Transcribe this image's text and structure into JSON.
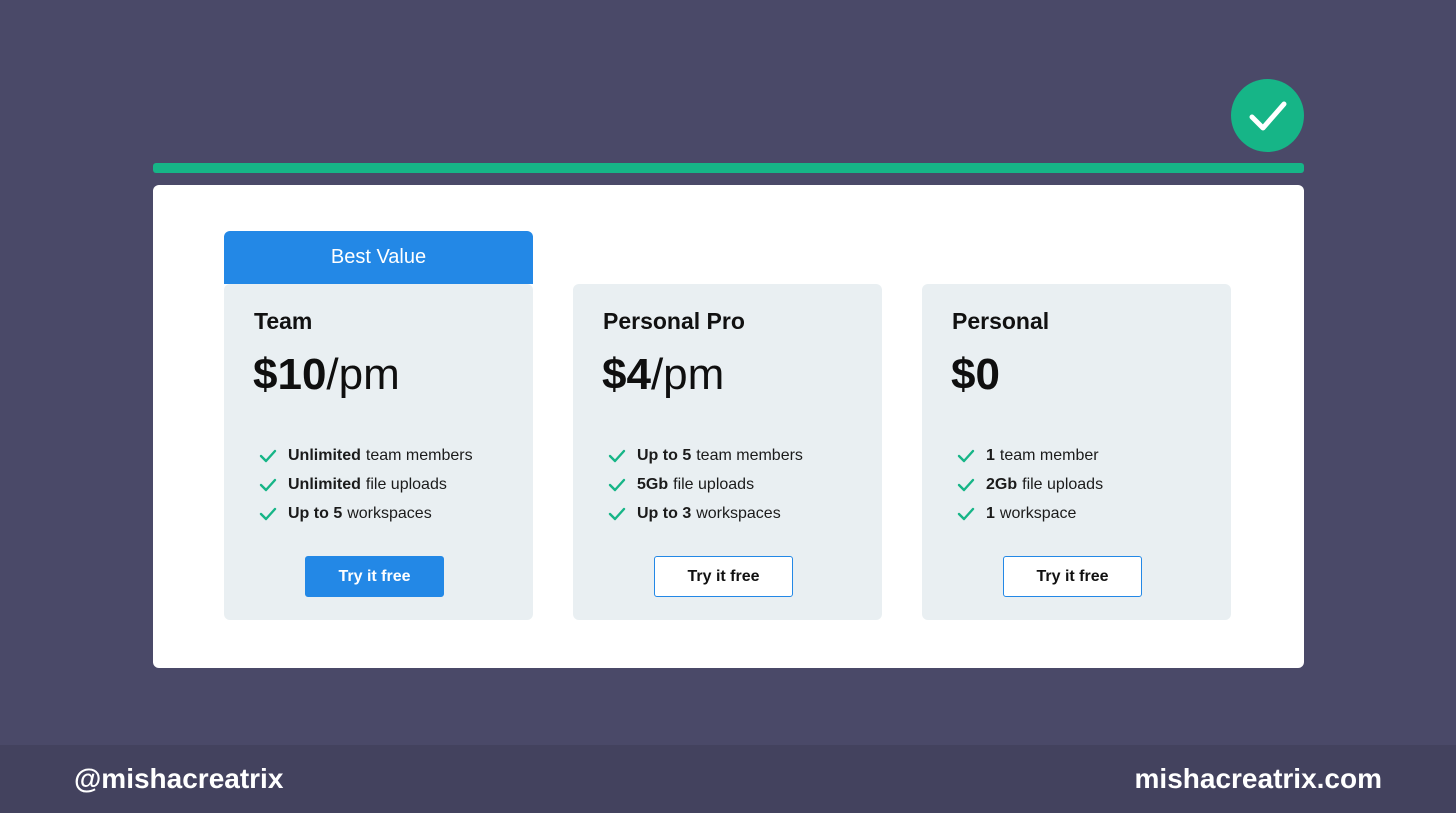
{
  "colors": {
    "background": "#4a4968",
    "accent_green": "#16b587",
    "accent_blue": "#2388e6",
    "card_bg": "#e9eff2",
    "footer_bg": "#43425e"
  },
  "badge": {
    "icon": "checkmark-icon"
  },
  "ribbon": {
    "label": "Best Value"
  },
  "plans": [
    {
      "name": "Team",
      "price": "$10",
      "period": "/pm",
      "features": [
        {
          "bold": "Unlimited",
          "text": "team members"
        },
        {
          "bold": "Unlimited",
          "text": "file uploads"
        },
        {
          "bold": "Up to 5",
          "text": "workspaces"
        }
      ],
      "button": "Try it free"
    },
    {
      "name": "Personal Pro",
      "price": "$4",
      "period": "/pm",
      "features": [
        {
          "bold": "Up to 5",
          "text": "team members"
        },
        {
          "bold": "5Gb",
          "text": "file uploads"
        },
        {
          "bold": "Up to 3",
          "text": "workspaces"
        }
      ],
      "button": "Try it free"
    },
    {
      "name": "Personal",
      "price": "$0",
      "period": "",
      "features": [
        {
          "bold": "1",
          "text": "team member"
        },
        {
          "bold": "2Gb",
          "text": "file uploads"
        },
        {
          "bold": "1",
          "text": "workspace"
        }
      ],
      "button": "Try it free"
    }
  ],
  "footer": {
    "handle": "@mishacreatrix",
    "site": "mishacreatrix.com"
  }
}
